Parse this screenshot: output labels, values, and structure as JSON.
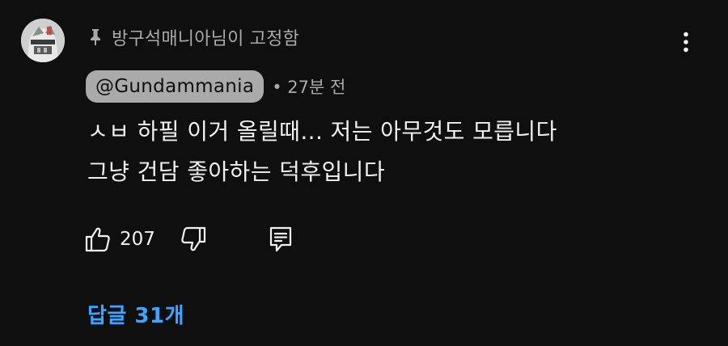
{
  "comment": {
    "pinned_by": "방구석매니아님이 고정함",
    "author": "@Gundammania",
    "time": "• 27분 전",
    "text_lines": [
      "ㅅㅂ 하필 이거 올릴때... 저는 아무것도 모릅니다",
      "그냥 건담 좋아하는 덕후입니다"
    ],
    "like_count": "207",
    "replies_label": "답글 31개"
  },
  "icons": {
    "avatar": "avatar",
    "pin": "pin-icon",
    "more": "more-vert-icon",
    "like": "thumbs-up-icon",
    "dislike": "thumbs-down-icon",
    "reply": "reply-icon"
  },
  "colors": {
    "background": "#0f0f0f",
    "text_primary": "#f1f1f1",
    "text_secondary": "#aaaaaa",
    "author_chip_bg": "#aaaaaa",
    "link_blue": "#3ea6ff"
  }
}
